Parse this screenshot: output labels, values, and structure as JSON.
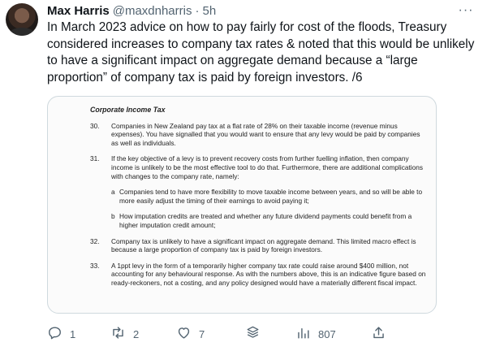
{
  "tweet": {
    "author_name": "Max Harris",
    "handle": "@maxdnharris",
    "separator": "·",
    "time": "5h",
    "more_label": "···",
    "text": "In March 2023 advice on how to pay fairly for cost of the floods, Treasury considered increases to company tax rates & noted that this would be unlikely to have a significant impact on aggregate demand because a “large proportion” of company tax is paid by foreign investors. /6"
  },
  "document": {
    "title": "Corporate Income Tax",
    "paragraphs": [
      {
        "num": "30.",
        "text": "Companies in New Zealand pay tax at a flat rate of 28% on their taxable income (revenue minus expenses). You have signalled that you would want to ensure that any levy would be paid by companies as well as individuals."
      },
      {
        "num": "31.",
        "text": "If the key objective of a levy is to prevent recovery costs from further fuelling inflation, then company income is unlikely to be the most effective tool to do that. Furthermore, there are additional complications with changes to the company rate, namely:"
      }
    ],
    "sub_items": [
      {
        "letter": "a",
        "text": "Companies tend to have more flexibility to move taxable income between years, and so will be able to more easily adjust the timing of their earnings to avoid paying it;"
      },
      {
        "letter": "b",
        "text": "How imputation credits are treated and whether any future dividend payments could benefit from a higher imputation credit amount;"
      }
    ],
    "paragraphs_after": [
      {
        "num": "32.",
        "text": "Company tax is unlikely to have a significant impact on aggregate demand. This limited macro effect is because a large proportion of company tax is paid by foreign investors."
      },
      {
        "num": "33.",
        "text": "A 1ppt levy in the form of a temporarily higher company tax rate could raise around $400 million, not accounting for any behavioural response. As with the numbers above, this is an indicative figure based on ready-reckoners, not a costing, and any policy designed would have a materially different fiscal impact."
      }
    ]
  },
  "actions": {
    "replies": "1",
    "retweets": "2",
    "likes": "7",
    "views": "807",
    "icons": [
      "reply-icon",
      "retweet-icon",
      "like-icon",
      "stack-icon",
      "views-icon",
      "share-icon"
    ]
  },
  "colors": {
    "text": "#0f1419",
    "secondary": "#536471",
    "border": "#cfd9de"
  }
}
